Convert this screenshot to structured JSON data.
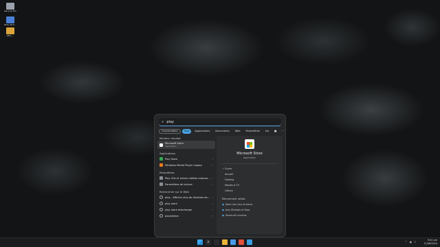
{
  "desktop": {
    "icons": [
      {
        "label": "Recycle Bin",
        "color": "#9aa3ad"
      },
      {
        "label": "RDA_Tech...",
        "color": "#4a7fd6"
      },
      {
        "label": "RDA_...",
        "color": "#d9a53a"
      }
    ]
  },
  "search": {
    "value": "play",
    "filters": [
      {
        "label": "Conversation",
        "outlined": true
      },
      {
        "label": "Tout",
        "active": true
      },
      {
        "label": "Applications"
      },
      {
        "label": "Documents"
      },
      {
        "label": "Web"
      },
      {
        "label": "Paramètres"
      },
      {
        "label": "Do"
      },
      {
        "label": "■"
      },
      {
        "label": "···"
      }
    ]
  },
  "left": {
    "best_title": "Meilleur résultat",
    "best": {
      "title": "Microsoft Store",
      "subtitle": "Application"
    },
    "apps_title": "Applications",
    "apps": [
      {
        "label": "Play Store"
      },
      {
        "label": "Windows Media Player Legacy"
      }
    ],
    "settings_title": "Paramètres",
    "settings": [
      {
        "label": "Play CDs et autres médias automatiquement"
      },
      {
        "label": "Paramètres de lecture"
      }
    ],
    "web_title": "Rechercher sur le Web",
    "web": [
      {
        "label": "play - Afficher plus de résultats de recherche"
      },
      {
        "label": "play store"
      },
      {
        "label": "play store telecharger"
      },
      {
        "label": "playstation"
      }
    ]
  },
  "right": {
    "app_name": "Microsoft Store",
    "app_type": "Application",
    "actions": [
      {
        "icon": "↗",
        "label": "Ouvrir"
      },
      {
        "icon": "",
        "label": "Accueil"
      },
      {
        "icon": "",
        "label": "Gaming"
      },
      {
        "icon": "",
        "label": "Movies & TV"
      },
      {
        "icon": "",
        "label": "Library"
      }
    ],
    "recent_title": "Récemment utilisé",
    "recent": [
      {
        "label": "Xbox Live: jeux et bonus"
      },
      {
        "label": "Jeux Windows et Xbox"
      },
      {
        "label": "Minecraft Launcher"
      }
    ]
  },
  "tray": {
    "time": "9:41 pm",
    "date": "11/06/2024"
  },
  "colors": {
    "accent": "#4aa3e0",
    "panel": "#262729",
    "taskbar": "#1b1c1e"
  }
}
